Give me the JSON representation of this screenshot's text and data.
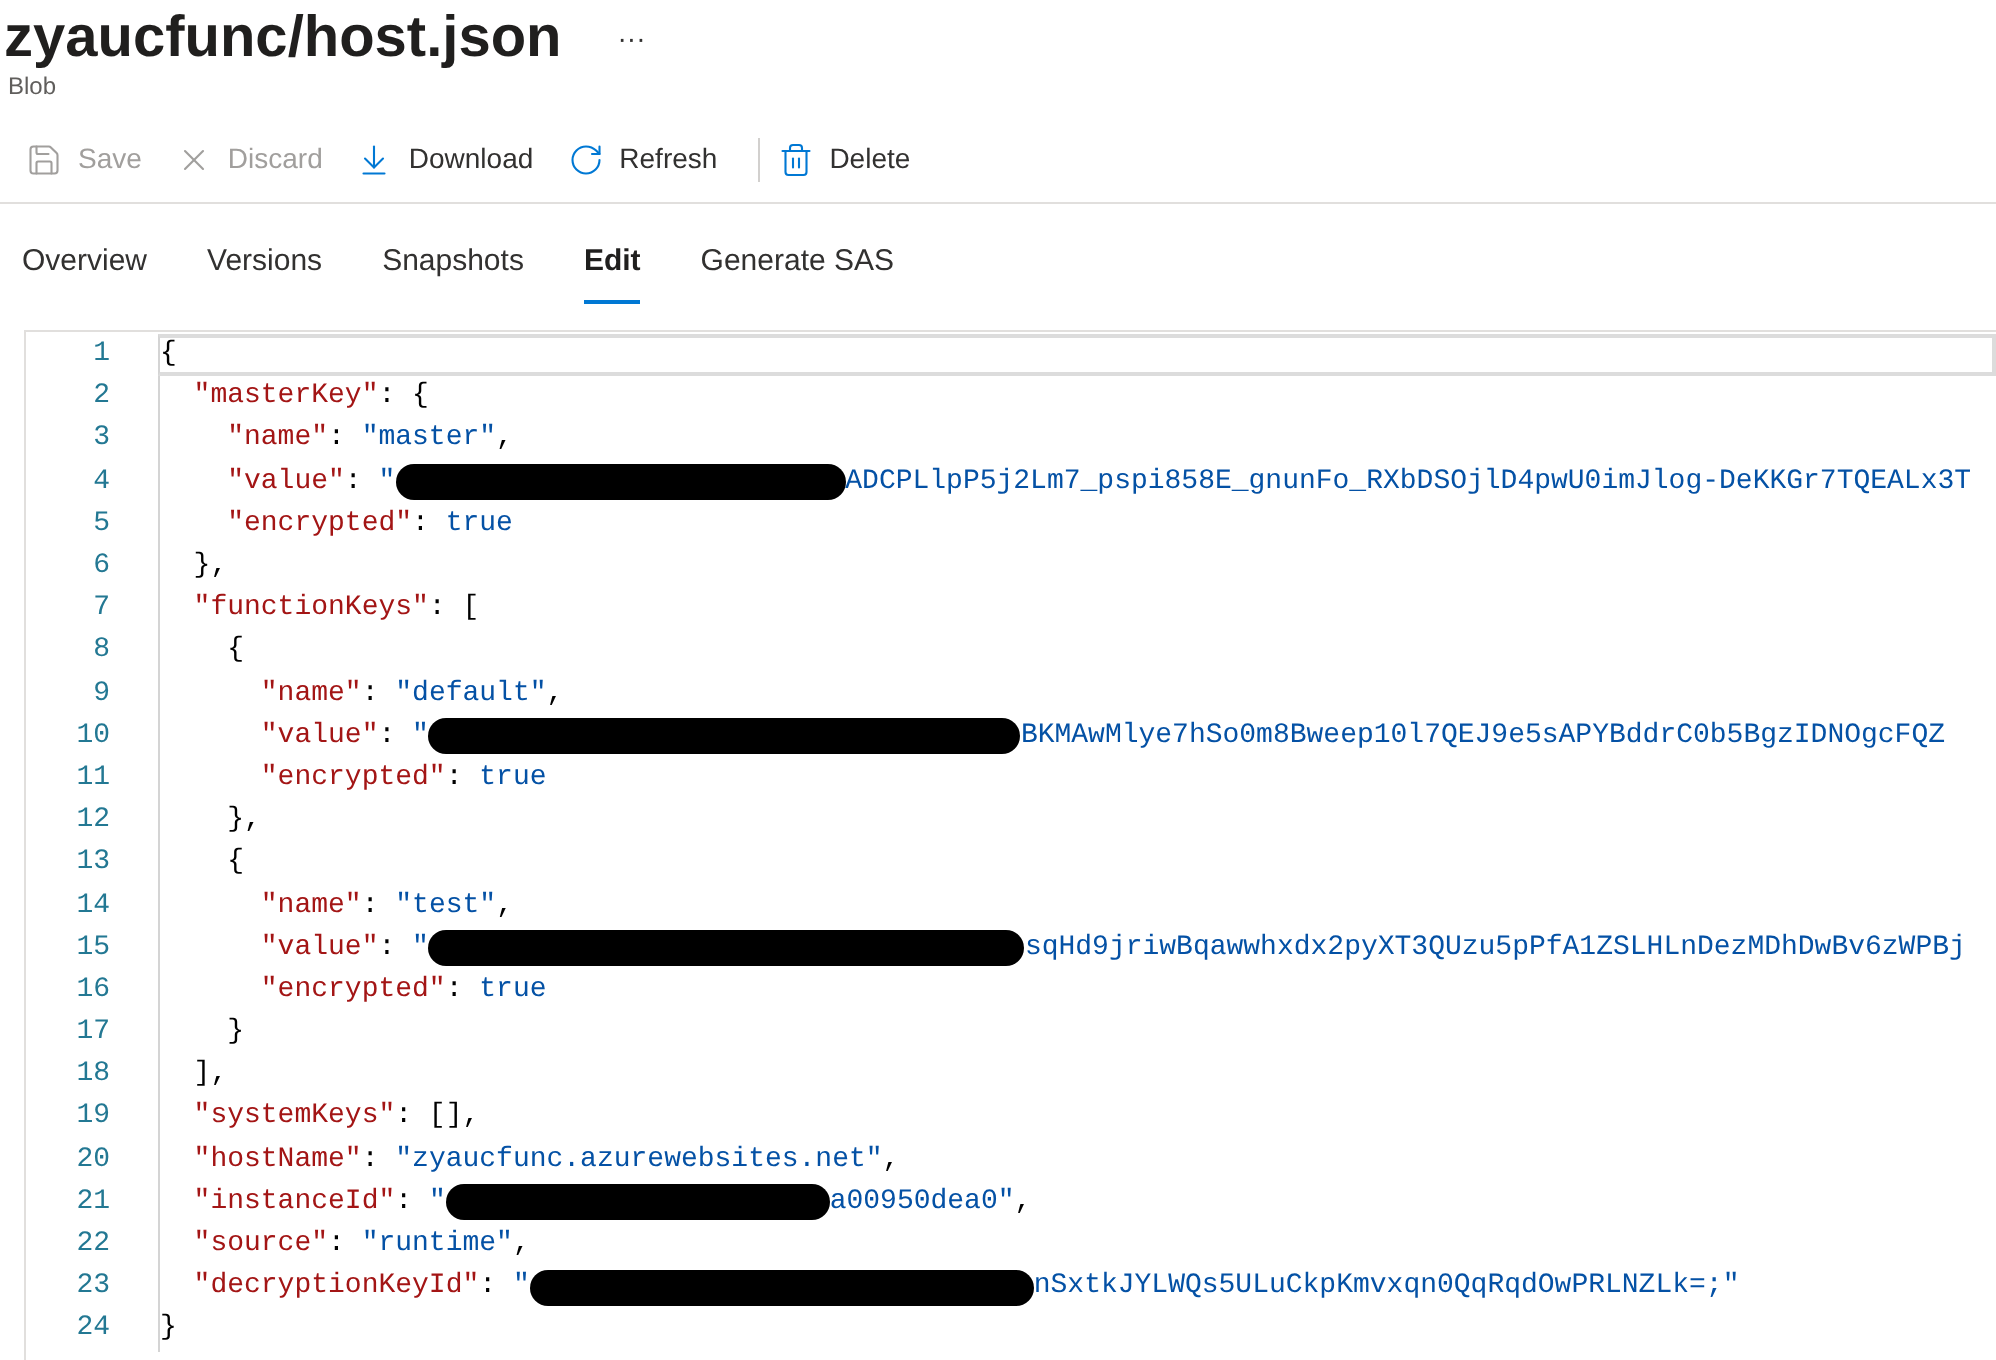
{
  "header": {
    "title": "zyaucfunc/host.json",
    "more": "···",
    "subtitle": "Blob"
  },
  "toolbar": [
    {
      "kind": "save",
      "label": "Save",
      "disabled": true
    },
    {
      "kind": "discard",
      "label": "Discard",
      "disabled": true
    },
    {
      "kind": "download",
      "label": "Download",
      "disabled": false
    },
    {
      "kind": "refresh",
      "label": "Refresh",
      "disabled": false
    },
    {
      "kind": "delete",
      "label": "Delete",
      "disabled": false
    }
  ],
  "tabs": [
    {
      "label": "Overview",
      "selected": false
    },
    {
      "label": "Versions",
      "selected": false
    },
    {
      "label": "Snapshots",
      "selected": false
    },
    {
      "label": "Edit",
      "selected": true
    },
    {
      "label": "Generate SAS",
      "selected": false
    }
  ],
  "editor": {
    "lines": [
      {
        "number": "1",
        "current": true,
        "tokens": [
          {
            "kind": "punct",
            "text": "{"
          }
        ]
      },
      {
        "number": "2",
        "current": false,
        "tokens": [
          {
            "kind": "key",
            "text": "  \"masterKey\""
          },
          {
            "kind": "punct",
            "text": ": {"
          }
        ]
      },
      {
        "number": "3",
        "current": false,
        "tokens": [
          {
            "kind": "key",
            "text": "    \"name\""
          },
          {
            "kind": "punct",
            "text": ": "
          },
          {
            "kind": "string",
            "text": "\"master\""
          },
          {
            "kind": "punct",
            "text": ","
          }
        ]
      },
      {
        "number": "4",
        "current": false,
        "tokens": [
          {
            "kind": "key",
            "text": "    \"value\""
          },
          {
            "kind": "punct",
            "text": ": "
          },
          {
            "kind": "string",
            "text": "\""
          },
          {
            "kind": "redacted"
          },
          {
            "kind": "string",
            "text": "ADCPLlpP5j2Lm7_pspi858E_gnunFo_RXbDSOjlD4pwU0imJlog-DeKKGr7TQEALx3T"
          }
        ]
      },
      {
        "number": "5",
        "current": false,
        "tokens": [
          {
            "kind": "key",
            "text": "    \"encrypted\""
          },
          {
            "kind": "punct",
            "text": ": "
          },
          {
            "kind": "literal",
            "text": "true"
          }
        ]
      },
      {
        "number": "6",
        "current": false,
        "tokens": [
          {
            "kind": "punct",
            "text": "  },"
          }
        ]
      },
      {
        "number": "7",
        "current": false,
        "tokens": [
          {
            "kind": "key",
            "text": "  \"functionKeys\""
          },
          {
            "kind": "punct",
            "text": ": ["
          }
        ]
      },
      {
        "number": "8",
        "current": false,
        "tokens": [
          {
            "kind": "punct",
            "text": "    {"
          }
        ]
      },
      {
        "number": "9",
        "current": false,
        "tokens": [
          {
            "kind": "key",
            "text": "      \"name\""
          },
          {
            "kind": "punct",
            "text": ": "
          },
          {
            "kind": "string",
            "text": "\"default\""
          },
          {
            "kind": "punct",
            "text": ","
          }
        ]
      },
      {
        "number": "10",
        "current": false,
        "tokens": [
          {
            "kind": "key",
            "text": "      \"value\""
          },
          {
            "kind": "punct",
            "text": ": "
          },
          {
            "kind": "string",
            "text": "\""
          },
          {
            "kind": "redacted"
          },
          {
            "kind": "string",
            "text": "BKMAwMlye7hSo0m8Bweep10l7QEJ9e5sAPYBddrC0b5BgzIDNOgcFQZ"
          }
        ]
      },
      {
        "number": "11",
        "current": false,
        "tokens": [
          {
            "kind": "key",
            "text": "      \"encrypted\""
          },
          {
            "kind": "punct",
            "text": ": "
          },
          {
            "kind": "literal",
            "text": "true"
          }
        ]
      },
      {
        "number": "12",
        "current": false,
        "tokens": [
          {
            "kind": "punct",
            "text": "    },"
          }
        ]
      },
      {
        "number": "13",
        "current": false,
        "tokens": [
          {
            "kind": "punct",
            "text": "    {"
          }
        ]
      },
      {
        "number": "14",
        "current": false,
        "tokens": [
          {
            "kind": "key",
            "text": "      \"name\""
          },
          {
            "kind": "punct",
            "text": ": "
          },
          {
            "kind": "string",
            "text": "\"test\""
          },
          {
            "kind": "punct",
            "text": ","
          }
        ]
      },
      {
        "number": "15",
        "current": false,
        "tokens": [
          {
            "kind": "key",
            "text": "      \"value\""
          },
          {
            "kind": "punct",
            "text": ": "
          },
          {
            "kind": "string",
            "text": "\""
          },
          {
            "kind": "redacted"
          },
          {
            "kind": "string",
            "text": "sqHd9jriwBqawwhxdx2pyXT3QUzu5pPfA1ZSLHLnDezMDhDwBv6zWPBj"
          }
        ]
      },
      {
        "number": "16",
        "current": false,
        "tokens": [
          {
            "kind": "key",
            "text": "      \"encrypted\""
          },
          {
            "kind": "punct",
            "text": ": "
          },
          {
            "kind": "literal",
            "text": "true"
          }
        ]
      },
      {
        "number": "17",
        "current": false,
        "tokens": [
          {
            "kind": "punct",
            "text": "    }"
          }
        ]
      },
      {
        "number": "18",
        "current": false,
        "tokens": [
          {
            "kind": "punct",
            "text": "  ],"
          }
        ]
      },
      {
        "number": "19",
        "current": false,
        "tokens": [
          {
            "kind": "key",
            "text": "  \"systemKeys\""
          },
          {
            "kind": "punct",
            "text": ": [],"
          }
        ]
      },
      {
        "number": "20",
        "current": false,
        "tokens": [
          {
            "kind": "key",
            "text": "  \"hostName\""
          },
          {
            "kind": "punct",
            "text": ": "
          },
          {
            "kind": "string",
            "text": "\"zyaucfunc.azurewebsites.net\""
          },
          {
            "kind": "punct",
            "text": ","
          }
        ]
      },
      {
        "number": "21",
        "current": false,
        "tokens": [
          {
            "kind": "key",
            "text": "  \"instanceId\""
          },
          {
            "kind": "punct",
            "text": ": "
          },
          {
            "kind": "string",
            "text": "\""
          },
          {
            "kind": "redacted"
          },
          {
            "kind": "string",
            "text": "a00950dea0\""
          },
          {
            "kind": "punct",
            "text": ","
          }
        ]
      },
      {
        "number": "22",
        "current": false,
        "tokens": [
          {
            "kind": "key",
            "text": "  \"source\""
          },
          {
            "kind": "punct",
            "text": ": "
          },
          {
            "kind": "string",
            "text": "\"runtime\""
          },
          {
            "kind": "punct",
            "text": ","
          }
        ]
      },
      {
        "number": "23",
        "current": false,
        "tokens": [
          {
            "kind": "key",
            "text": "  \"decryptionKeyId\""
          },
          {
            "kind": "punct",
            "text": ": "
          },
          {
            "kind": "string",
            "text": "\""
          },
          {
            "kind": "redacted"
          },
          {
            "kind": "string",
            "text": "nSxtkJYLWQs5ULuCkpKmvxqn0QqRqdOwPRLNZLk=;\""
          }
        ]
      },
      {
        "number": "24",
        "current": false,
        "tokens": [
          {
            "kind": "punct",
            "text": "}"
          }
        ]
      }
    ]
  }
}
